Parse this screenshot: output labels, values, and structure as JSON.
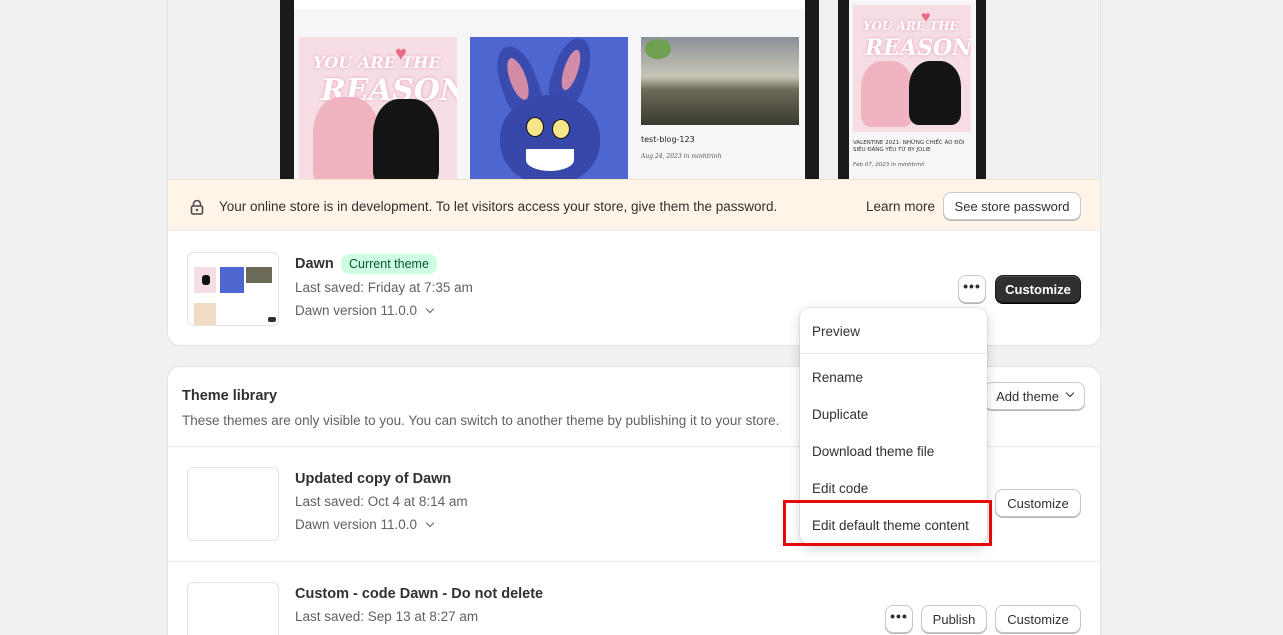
{
  "banner": {
    "message": "Your online store is in development. To let visitors access your store, give them the password.",
    "learn_more": "Learn more",
    "see_password": "See store password"
  },
  "preview": {
    "blog_title": "test-blog-123",
    "blog_meta": "Aug 24, 2023 in minhtrinh",
    "product_text": "YOU ARE THE REASON",
    "mobile_caption": "VALENTINE 2021: NHỮNG CHIẾC ÁO ĐÔI SIÊU ĐÁNG YÊU TỪ BY JOLIE",
    "mobile_meta": "Feb 07, 2023 in minhtrinh"
  },
  "current_theme": {
    "name": "Dawn",
    "badge": "Current theme",
    "last_saved": "Last saved: Friday at 7:35 am",
    "version": "Dawn version 11.0.0",
    "more_label": "•••",
    "customize": "Customize"
  },
  "menu": {
    "items": [
      "Preview",
      "Rename",
      "Duplicate",
      "Download theme file",
      "Edit code",
      "Edit default theme content"
    ]
  },
  "library": {
    "title": "Theme library",
    "subtitle": "These themes are only visible to you. You can switch to another theme by publishing it to your store.",
    "add_theme": "Add theme",
    "themes": [
      {
        "name": "Updated copy of Dawn",
        "last_saved": "Last saved: Oct 4 at 8:14 am",
        "version": "Dawn version 11.0.0",
        "customize": "Customize"
      },
      {
        "name": "Custom - code Dawn - Do not delete",
        "last_saved": "Last saved: Sep 13 at 8:27 am",
        "more_label": "•••",
        "publish": "Publish",
        "customize": "Customize"
      }
    ]
  },
  "colors": {
    "banner_bg": "#fff4e7",
    "badge_bg": "#cdfee1",
    "badge_text": "#0c5132",
    "primary_button": "#303030",
    "highlight": "#e20a0a"
  }
}
